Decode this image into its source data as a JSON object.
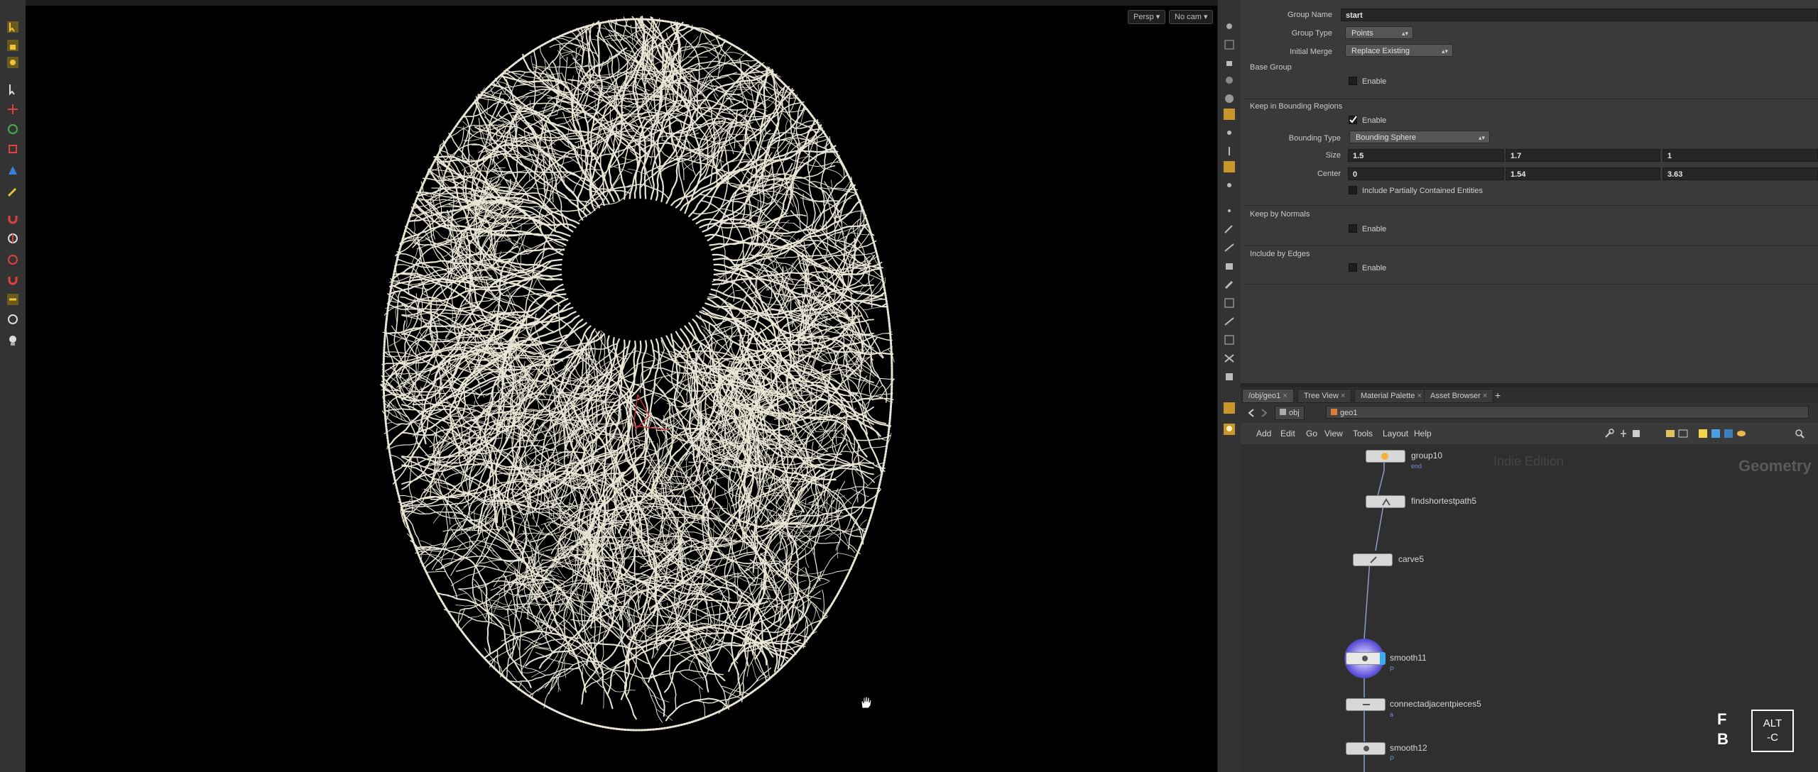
{
  "viewport": {
    "persp_label": "Persp",
    "cam_label": "No cam"
  },
  "params": {
    "group_name_label": "Group Name",
    "group_name_value": "start",
    "group_type_label": "Group Type",
    "group_type_value": "Points",
    "initial_merge_label": "Initial Merge",
    "initial_merge_value": "Replace Existing",
    "base_group_title": "Base Group",
    "base_group_enable": "Enable",
    "bounding_title": "Keep in Bounding Regions",
    "bounding_enable": "Enable",
    "bounding_type_label": "Bounding Type",
    "bounding_type_value": "Bounding Sphere",
    "size_label": "Size",
    "size_values": [
      "1.5",
      "1.7",
      "1"
    ],
    "center_label": "Center",
    "center_values": [
      "0",
      "1.54",
      "3.63"
    ],
    "partial_label": "Include Partially Contained Entities",
    "normals_title": "Keep by Normals",
    "normals_enable": "Enable",
    "edges_title": "Include by Edges",
    "edges_enable": "Enable"
  },
  "network": {
    "tabs": [
      "/obj/geo1",
      "Tree View",
      "Material Palette",
      "Asset Browser"
    ],
    "path_obj": "obj",
    "path_geo": "geo1",
    "menu": [
      "Add",
      "Edit",
      "Go",
      "View",
      "Tools",
      "Layout",
      "Help"
    ],
    "watermark": "Indie Edition",
    "context": "Geometry",
    "nodes": [
      {
        "label": "group10",
        "sub": "end"
      },
      {
        "label": "findshortestpath5",
        "sub": ""
      },
      {
        "label": "carve5",
        "sub": ""
      },
      {
        "label": "smooth11",
        "sub": "P"
      },
      {
        "label": "connectadjacentpieces5",
        "sub": "a"
      },
      {
        "label": "smooth12",
        "sub": "P"
      }
    ]
  },
  "branding": {
    "fb_top": "F",
    "fb_bottom": "B",
    "alt_line1": "ALT",
    "alt_line2": "-C"
  },
  "colors": {
    "viewport_bg": "#000000",
    "vein_color": "#e9e6d6",
    "selection_ring": "#5a4fd6",
    "accent_blue": "#3fa9f5"
  }
}
